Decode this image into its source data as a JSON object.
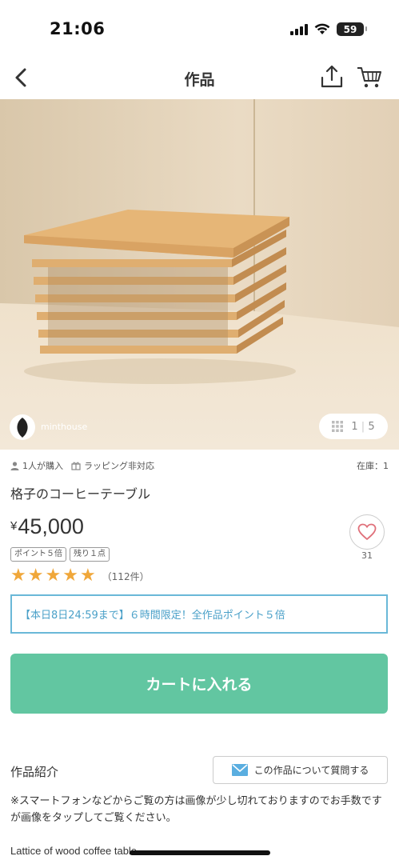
{
  "status_bar": {
    "time": "21:06",
    "battery": "59"
  },
  "nav": {
    "title": "作品"
  },
  "gallery": {
    "shop_name": "minthouse",
    "current": "1",
    "total": "5"
  },
  "meta": {
    "buyers": "1人が購入",
    "wrapping": "ラッピング非対応",
    "stock": "在庫：1"
  },
  "product": {
    "title": "格子のコーヒーテーブル",
    "currency": "¥",
    "price": "45,000",
    "badges": [
      "ポイント５倍",
      "残り１点"
    ],
    "rating_stars": 5,
    "review_count": "（112件）",
    "favorite_count": "31"
  },
  "campaign": {
    "text": "【本日8日24:59まで】６時間限定！全作品ポイント５倍"
  },
  "cart": {
    "label": "カートに入れる"
  },
  "intro": {
    "title": "作品紹介",
    "ask_label": "この作品について質問する",
    "note": "※スマートフォンなどからご覧の方は画像が少し切れておりますのでお手数ですが画像をタップしてご覧ください。",
    "first_line": "Lattice of wood coffee table"
  },
  "colors": {
    "accent_green": "#62c6a1",
    "campaign_blue": "#4aa0c8",
    "star": "#f0a73a",
    "heart": "#e0707a"
  }
}
